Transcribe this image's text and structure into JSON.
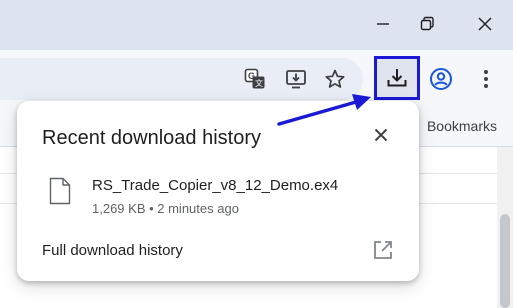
{
  "window_controls": {
    "minimize_icon": "minimize-icon",
    "restore_icon": "restore-icon",
    "close_icon": "close-icon"
  },
  "toolbar": {
    "icons": [
      "translate-icon",
      "install-app-icon",
      "bookmark-star-icon",
      "download-icon",
      "profile-icon",
      "more-menu-icon"
    ]
  },
  "bookmarks_bar": {
    "label": "Bookmarks"
  },
  "download_popup": {
    "title": "Recent download history",
    "items": [
      {
        "file_name": "RS_Trade_Copier_v8_12_Demo.ex4",
        "meta": "1,269 KB • 2 minutes ago"
      }
    ],
    "full_history_label": "Full download history"
  },
  "colors": {
    "highlight_border": "#1a1ad6",
    "arrow": "#1a1ad6",
    "titlebar": "#dde4f0",
    "toolbar": "#f5f7fb"
  }
}
